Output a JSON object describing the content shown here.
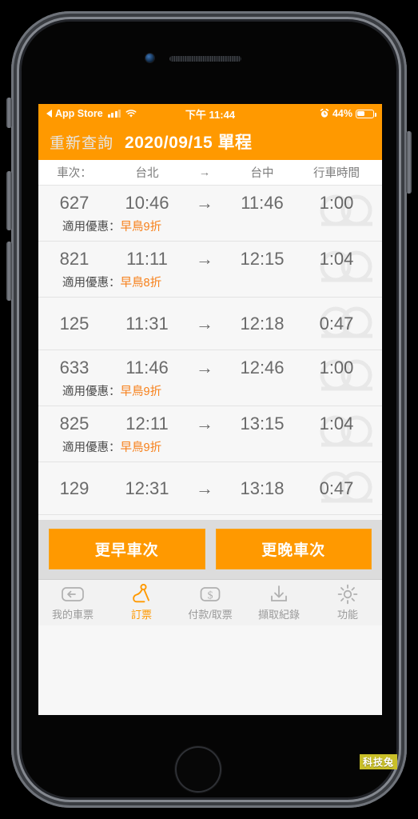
{
  "status_bar": {
    "back_app_label": "App Store",
    "signal_icon": "signal-bars-icon",
    "wifi_icon": "wifi-icon",
    "time": "下午 11:44",
    "alarm_icon": "alarm-clock-icon",
    "battery_percent_label": "44%",
    "battery_level": 44
  },
  "nav_bar": {
    "back_label": "重新查詢",
    "title": "2020/09/15 單程",
    "background_color": "#ff9900"
  },
  "table": {
    "headers": {
      "train_no": "車次：",
      "origin": "台北",
      "arrow": "→",
      "destination": "台中",
      "duration": "行車時間"
    },
    "promo_prefix": "適用優惠：",
    "rows": [
      {
        "train_no": "627",
        "depart": "10:46",
        "arrow": "→",
        "arrive": "11:46",
        "duration": "1:00",
        "promo": "早鳥9折"
      },
      {
        "train_no": "821",
        "depart": "11:11",
        "arrow": "→",
        "arrive": "12:15",
        "duration": "1:04",
        "promo": "早鳥8折"
      },
      {
        "train_no": "125",
        "depart": "11:31",
        "arrow": "→",
        "arrive": "12:18",
        "duration": "0:47",
        "promo": ""
      },
      {
        "train_no": "633",
        "depart": "11:46",
        "arrow": "→",
        "arrive": "12:46",
        "duration": "1:00",
        "promo": "早鳥9折"
      },
      {
        "train_no": "825",
        "depart": "12:11",
        "arrow": "→",
        "arrive": "13:15",
        "duration": "1:04",
        "promo": "早鳥9折"
      },
      {
        "train_no": "129",
        "depart": "12:31",
        "arrow": "→",
        "arrive": "13:18",
        "duration": "0:47",
        "promo": ""
      }
    ]
  },
  "action_bar": {
    "earlier_label": "更早車次",
    "later_label": "更晚車次",
    "button_color": "#ff9900"
  },
  "tab_bar": {
    "active_color": "#ff9900",
    "inactive_color": "#9a9a9a",
    "items": [
      {
        "label": "我的車票",
        "icon": "ticket-return-icon",
        "active": false
      },
      {
        "label": "訂票",
        "icon": "seated-passenger-icon",
        "active": true
      },
      {
        "label": "付款/取票",
        "icon": "dollar-ticket-icon",
        "active": false
      },
      {
        "label": "擷取紀錄",
        "icon": "download-icon",
        "active": false
      },
      {
        "label": "功能",
        "icon": "gear-icon",
        "active": false
      }
    ]
  },
  "watermark": {
    "text": "科技兔"
  }
}
